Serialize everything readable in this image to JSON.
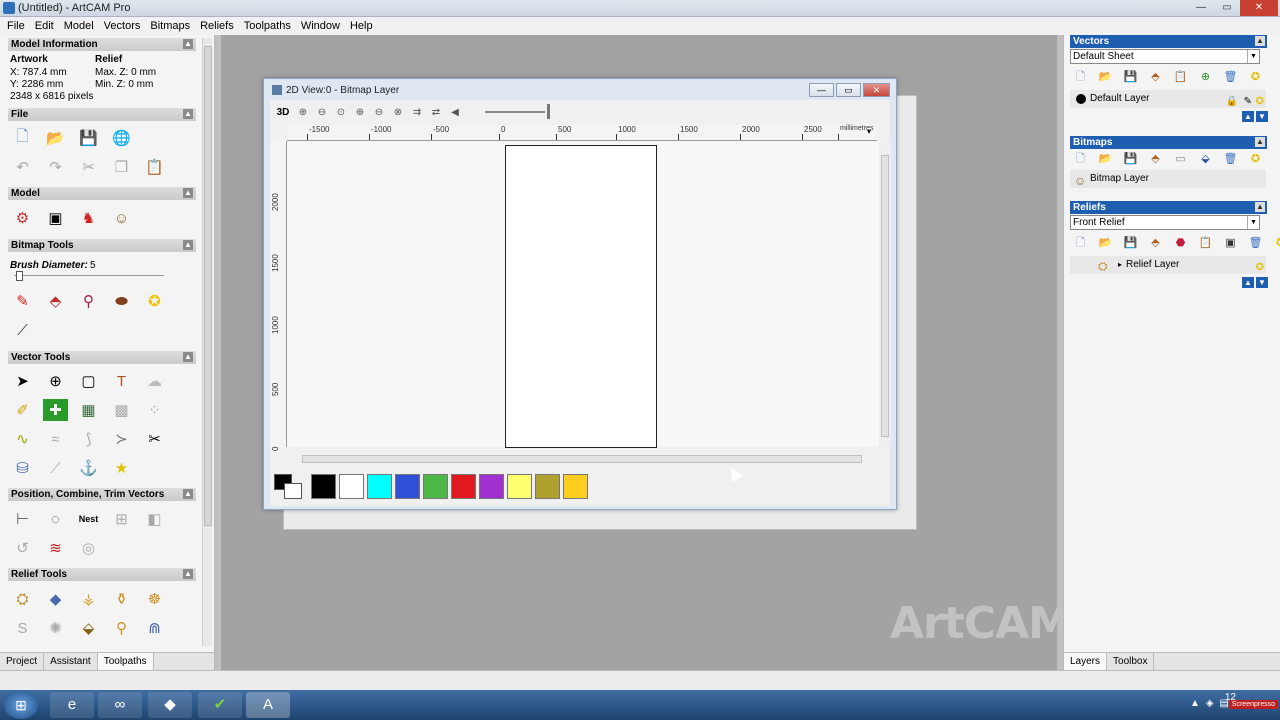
{
  "window": {
    "title": "(Untitled) - ArtCAM Pro",
    "minimize": "—",
    "restore": "▭",
    "close": "✕"
  },
  "menu": [
    "File",
    "Edit",
    "Model",
    "Vectors",
    "Bitmaps",
    "Reliefs",
    "Toolpaths",
    "Window",
    "Help"
  ],
  "left_panel": {
    "model_information": {
      "header": "Model Information",
      "artwork_label": "Artwork",
      "relief_label": "Relief",
      "x": "X: 787.4 mm",
      "y": "Y: 2286 mm",
      "pixels": "2348 x 6816 pixels",
      "max_z": "Max. Z: 0 mm",
      "min_z": "Min. Z: 0 mm"
    },
    "sections": {
      "file": "File",
      "model": "Model",
      "bitmap_tools": "Bitmap Tools",
      "vector_tools": "Vector Tools",
      "position": "Position, Combine, Trim Vectors",
      "relief_tools": "Relief Tools"
    },
    "brush_label": "Brush Diameter:",
    "brush_value": "5",
    "collapse_glyph": "▲",
    "tabs": [
      "Project",
      "Assistant",
      "Toolpaths"
    ]
  },
  "view": {
    "title": "2D View:0 - Bitmap Layer",
    "toolbar_3d": "3D",
    "ruler_units": "millimetres",
    "h_ticks": [
      "-1500",
      "-1000",
      "-500",
      "0",
      "500",
      "1000",
      "1500",
      "2000",
      "2500"
    ],
    "v_ticks": [
      "2000",
      "1500",
      "1000",
      "500",
      "0"
    ],
    "palette": [
      "#000000",
      "#ffffff",
      "#00ffff",
      "#3050d8",
      "#4cb848",
      "#e01820",
      "#a030d0",
      "#ffff70",
      "#b0a030",
      "#ffcc20"
    ]
  },
  "watermark": "ArtCAM",
  "right_panel": {
    "vectors": {
      "header": "Vectors",
      "sheet": "Default Sheet",
      "layer": "Default Layer"
    },
    "bitmaps": {
      "header": "Bitmaps",
      "layer": "Bitmap Layer"
    },
    "reliefs": {
      "header": "Reliefs",
      "select": "Front Relief",
      "layer": "Relief Layer"
    },
    "tabs": [
      "Layers",
      "Toolbox"
    ]
  },
  "taskbar": {
    "clock": "12",
    "badge": "Screenpresso"
  }
}
